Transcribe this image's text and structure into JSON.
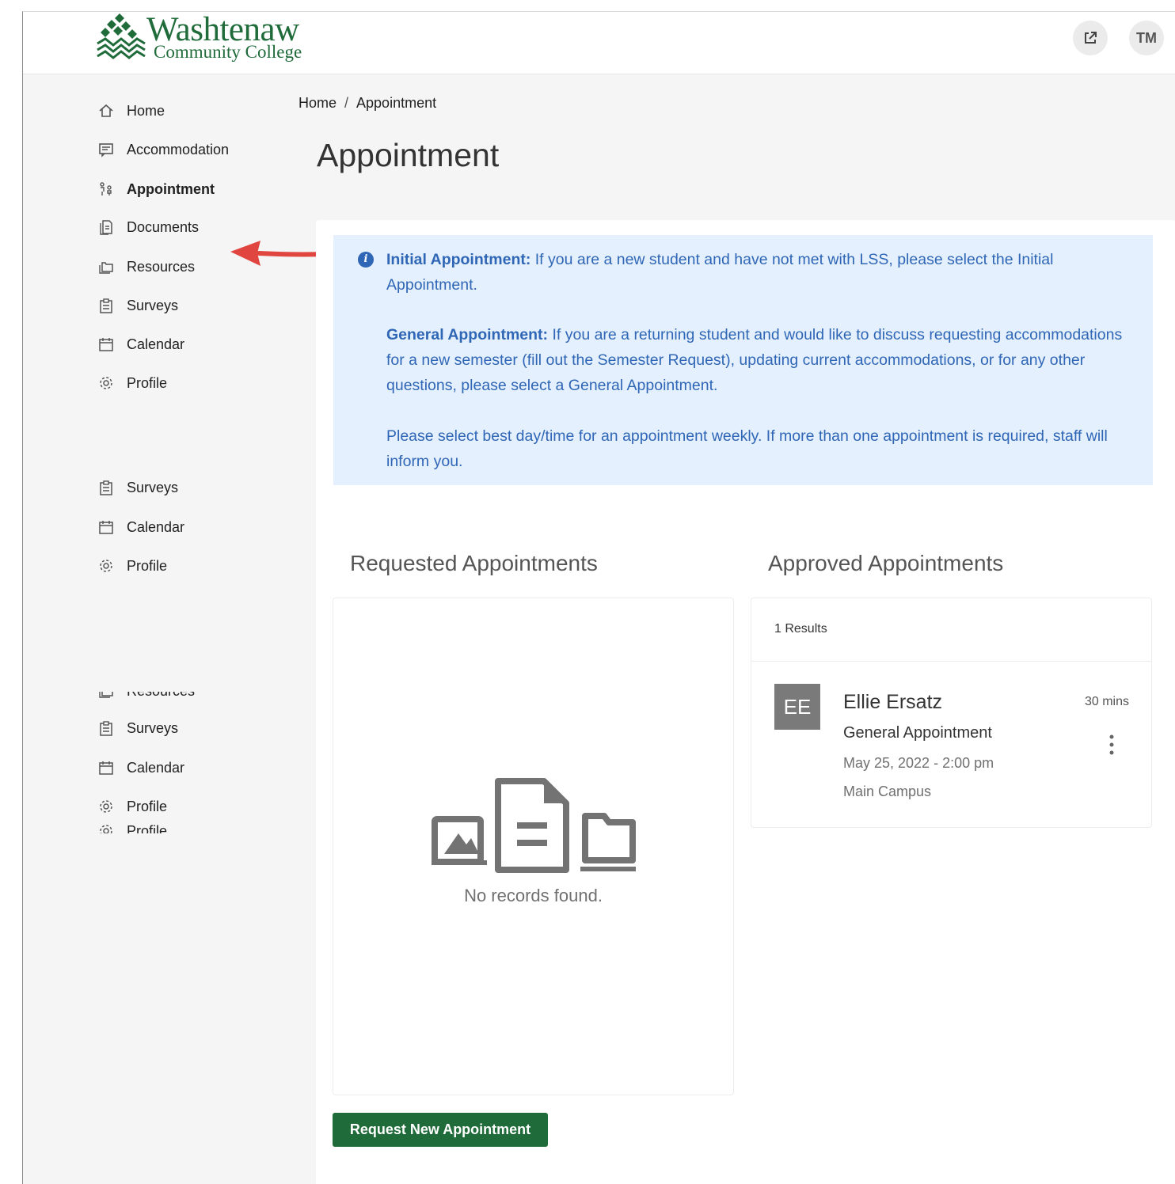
{
  "header": {
    "logo_name": "Washtenaw",
    "logo_subtitle": "Community College",
    "open_new_window_icon": "external-link-icon",
    "user_initials": "TM"
  },
  "sidebar": {
    "items": [
      {
        "label": "Home",
        "icon": "home-icon"
      },
      {
        "label": "Accommodation",
        "icon": "list-icon"
      },
      {
        "label": "Appointment",
        "icon": "people-icon",
        "active": true
      },
      {
        "label": "Documents",
        "icon": "document-icon"
      },
      {
        "label": "Resources",
        "icon": "folder-icon"
      },
      {
        "label": "Surveys",
        "icon": "clipboard-icon"
      },
      {
        "label": "Calendar",
        "icon": "calendar-icon"
      },
      {
        "label": "Profile",
        "icon": "gear-icon"
      }
    ],
    "repeat1": [
      {
        "label": "Surveys",
        "icon": "clipboard-icon"
      },
      {
        "label": "Calendar",
        "icon": "calendar-icon"
      },
      {
        "label": "Profile",
        "icon": "gear-icon"
      }
    ],
    "cut_top_label": "Resources",
    "repeat2": [
      {
        "label": "Surveys",
        "icon": "clipboard-icon"
      },
      {
        "label": "Calendar",
        "icon": "calendar-icon"
      },
      {
        "label": "Profile",
        "icon": "gear-icon"
      }
    ],
    "cut_bottom_label": "Profile"
  },
  "breadcrumb": {
    "home": "Home",
    "separator": "/",
    "current": "Appointment"
  },
  "page_title": "Appointment",
  "info": {
    "initial_title": "Initial Appointment:",
    "initial_text": " If you are a new student and have not met with LSS, please select the Initial Appointment.",
    "general_title": "General Appointment:",
    "general_text": " If you are a returning student and would like to discuss requesting accommodations for a new semester (fill out the Semester Request), updating current accommodations, or for any other questions, please select a General Appointment.",
    "weekly_text": "Please select best day/time for an appointment weekly. If more than one appointment is required, staff will inform you."
  },
  "requested": {
    "title": "Requested Appointments",
    "empty_text": "No records found."
  },
  "approved": {
    "title": "Approved Appointments",
    "results": "1 Results",
    "items": [
      {
        "initials": "EE",
        "name": "Ellie Ersatz",
        "duration": "30 mins",
        "type": "General Appointment",
        "datetime": "May 25, 2022 - 2:00 pm",
        "location": "Main Campus"
      }
    ]
  },
  "actions": {
    "request_new": "Request New Appointment"
  },
  "colors": {
    "brand_green": "#1f6b3a",
    "info_bg": "#e4f0fd",
    "info_text": "#2f66b5",
    "annotation_arrow": "#e0463f"
  }
}
